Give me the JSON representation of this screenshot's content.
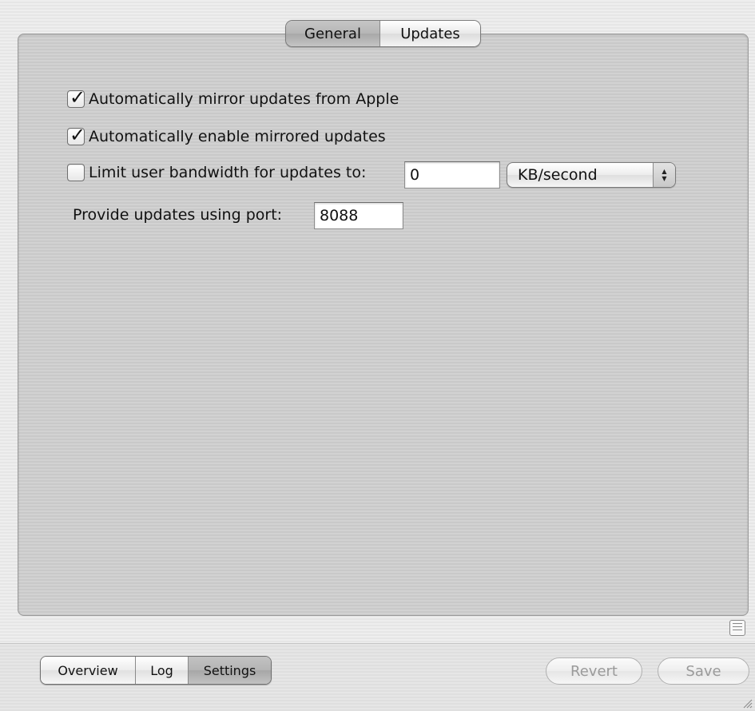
{
  "tabs": [
    {
      "label": "General",
      "selected": true
    },
    {
      "label": "Updates",
      "selected": false
    }
  ],
  "general": {
    "mirror_updates": {
      "label": "Automatically mirror updates from Apple",
      "checked": true
    },
    "enable_mirrored": {
      "label": "Automatically enable mirrored updates",
      "checked": true
    },
    "limit_bandwidth": {
      "label": "Limit user bandwidth for updates to:",
      "checked": false,
      "value": "0",
      "unit": "KB/second"
    },
    "port": {
      "label": "Provide updates using port:",
      "value": "8088"
    }
  },
  "bottom_tabs": [
    {
      "label": "Overview",
      "selected": false
    },
    {
      "label": "Log",
      "selected": false
    },
    {
      "label": "Settings",
      "selected": true
    }
  ],
  "buttons": {
    "revert": "Revert",
    "save": "Save"
  },
  "icons": {
    "checkmark": "check-icon",
    "popup_arrows": "up-down-arrows-icon",
    "list": "list-icon",
    "resize": "resize-grip-icon"
  }
}
